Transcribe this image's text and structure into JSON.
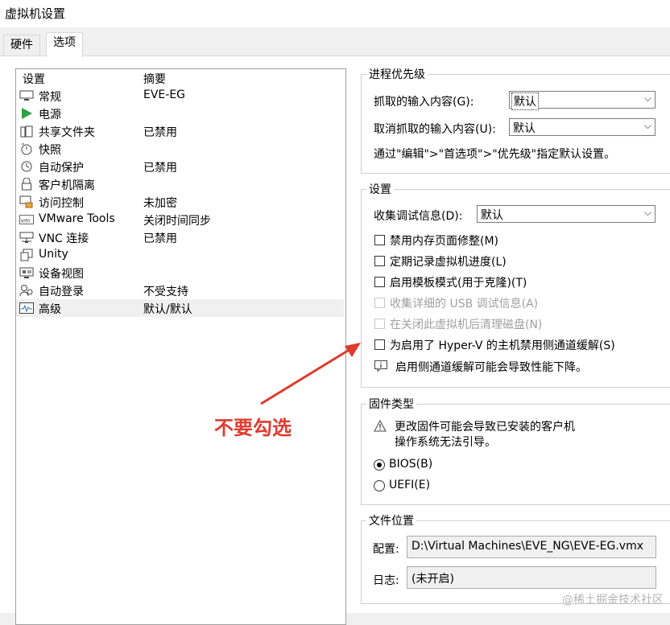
{
  "window": {
    "title": "虚拟机设置"
  },
  "tabs": [
    {
      "label": "硬件"
    },
    {
      "label": "选项"
    }
  ],
  "list": {
    "header_setting": "设置",
    "header_summary": "摘要",
    "items": [
      {
        "icon": "monitor-icon",
        "name": "常规",
        "summary": "EVE-EG"
      },
      {
        "icon": "power-play-icon",
        "name": "电源",
        "summary": ""
      },
      {
        "icon": "shared-folder-icon",
        "name": "共享文件夹",
        "summary": "已禁用"
      },
      {
        "icon": "snapshot-icon",
        "name": "快照",
        "summary": ""
      },
      {
        "icon": "autoprotect-clock-icon",
        "name": "自动保护",
        "summary": "已禁用"
      },
      {
        "icon": "lock-icon",
        "name": "客户机隔离",
        "summary": ""
      },
      {
        "icon": "access-control-icon",
        "name": "访问控制",
        "summary": "未加密"
      },
      {
        "icon": "vmware-tools-icon",
        "name": "VMware Tools",
        "summary": "关闭时间同步"
      },
      {
        "icon": "vnc-icon",
        "name": "VNC 连接",
        "summary": "已禁用"
      },
      {
        "icon": "unity-icon",
        "name": "Unity",
        "summary": ""
      },
      {
        "icon": "device-view-icon",
        "name": "设备视图",
        "summary": ""
      },
      {
        "icon": "autologin-icon",
        "name": "自动登录",
        "summary": "不受支持"
      },
      {
        "icon": "advanced-chart-icon",
        "name": "高级",
        "summary": "默认/默认"
      }
    ]
  },
  "process_priority": {
    "title": "进程优先级",
    "grabbed_label": "抓取的输入内容(G):",
    "grabbed_value": "默认",
    "ungrabbed_label": "取消抓取的输入内容(U):",
    "ungrabbed_value": "默认",
    "note": "通过\"编辑\">\"首选项\">\"优先级\"指定默认设置。"
  },
  "settings": {
    "title": "设置",
    "debug_label": "收集调试信息(D):",
    "debug_value": "默认",
    "checkboxes": [
      {
        "label": "禁用内存页面修整(M)",
        "disabled": false
      },
      {
        "label": "定期记录虚拟机进度(L)",
        "disabled": false
      },
      {
        "label": "启用模板模式(用于克隆)(T)",
        "disabled": false
      },
      {
        "label": "收集详细的 USB 调试信息(A)",
        "disabled": true
      },
      {
        "label": "在关闭此虚拟机后清理磁盘(N)",
        "disabled": true
      },
      {
        "label": "为启用了 Hyper-V 的主机禁用侧通道缓解(S)",
        "disabled": false
      }
    ],
    "info": "启用侧通道缓解可能会导致性能下降。"
  },
  "firmware": {
    "title": "固件类型",
    "warning_line1": "更改固件可能会导致已安装的客户机",
    "warning_line2": "操作系统无法引导。",
    "bios_label": "BIOS(B)",
    "uefi_label": "UEFI(E)",
    "selected": "BIOS"
  },
  "file_location": {
    "title": "文件位置",
    "config_label": "配置:",
    "config_value": "D:\\Virtual Machines\\EVE_NG\\EVE-EG.vmx",
    "log_label": "日志:",
    "log_value": "(未开启)"
  },
  "annotation": {
    "text": "不要勾选",
    "color": "#e03a2e"
  },
  "watermark": "@稀土掘金技术社区"
}
